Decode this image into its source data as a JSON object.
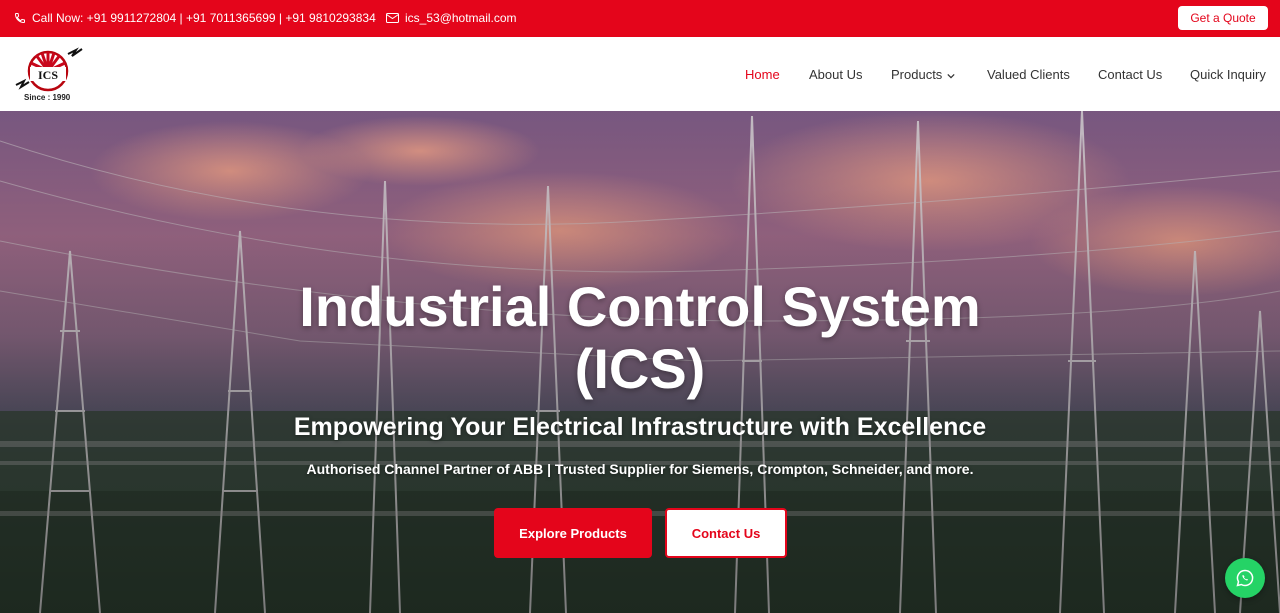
{
  "topbar": {
    "phone_text": "Call Now: +91 9911272804 | +91 7011365699 | +91 9810293834",
    "email_text": "ics_53@hotmail.com",
    "quote_label": "Get a Quote",
    "background_color": "#e4051b"
  },
  "logo": {
    "text": "ICS",
    "since": "Since : 1990"
  },
  "nav": {
    "items": [
      {
        "label": "Home",
        "active": true
      },
      {
        "label": "About Us"
      },
      {
        "label": "Products",
        "has_dropdown": true
      },
      {
        "label": "Valued Clients"
      },
      {
        "label": "Contact Us"
      },
      {
        "label": "Quick Inquiry"
      }
    ]
  },
  "hero": {
    "title_line1": "Industrial Control System",
    "title_line2": "(ICS)",
    "subtitle": "Empowering Your Electrical Infrastructure with Excellence",
    "description": "Authorised Channel Partner of ABB | Trusted Supplier for Siemens, Crompton, Schneider, and more.",
    "explore_label": "Explore Products",
    "contact_label": "Contact Us",
    "background": "substation-at-dusk"
  },
  "icons": {
    "phone": "phone-icon",
    "mail": "mail-icon",
    "chevron": "chevron-down-icon",
    "whatsapp": "whatsapp-icon"
  },
  "colors": {
    "accent": "#e4051b",
    "whatsapp": "#25d366"
  }
}
